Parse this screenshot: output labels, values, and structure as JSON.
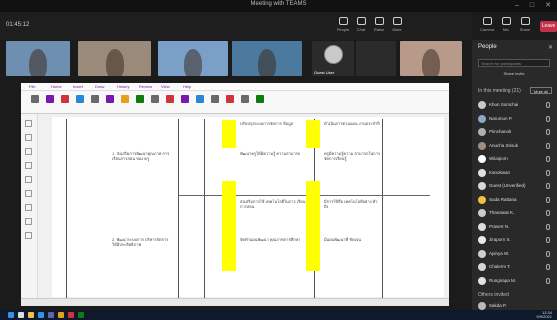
{
  "window": {
    "title": "Meeting with TEAMS",
    "controls": [
      "–",
      "□",
      "✕"
    ]
  },
  "meeting": {
    "name": "01:45:12",
    "toolbar": [
      {
        "icon": "people-icon",
        "label": "People"
      },
      {
        "icon": "chat-icon",
        "label": "Chat"
      },
      {
        "icon": "hand-icon",
        "label": "Raise"
      },
      {
        "icon": "more-icon",
        "label": "More"
      },
      {
        "icon": "camera-icon",
        "label": "Camera"
      },
      {
        "icon": "mic-icon",
        "label": "Mic"
      },
      {
        "icon": "share-icon",
        "label": "Share"
      }
    ],
    "leave_label": "Leave"
  },
  "tiles": [
    {
      "name": "",
      "bg": "#6f8fb0"
    },
    {
      "name": "",
      "bg": "#9a8a7a"
    },
    {
      "name": "",
      "bg": "#7aa0c8"
    },
    {
      "name": "",
      "bg": "#4c7a9e"
    },
    {
      "name": "Guest User",
      "bg": "#2b2b2b"
    },
    {
      "name": "",
      "bg": "#2b2b2b"
    },
    {
      "name": "",
      "bg": "#b79a8a"
    }
  ],
  "onenote": {
    "tabs": [
      "File",
      "Home",
      "Insert",
      "Draw",
      "History",
      "Review",
      "View",
      "Help"
    ],
    "page_rows": [
      {
        "left": "",
        "mid1": "ปรับปรุงระบบการจัดการ ข้อมูล",
        "mid2": "ดำเนินการตามแผน งานประจำปี"
      },
      {
        "left": "1. ส่งเสริมการพัฒนาคุณภาพ การเรียนการสอน ของ ครู",
        "mid1": "พัฒนาครูให้มีความรู้ ความสามารถ",
        "mid2": "ครูมีความรู้ความ สามารถในการ จัดการเรียนรู้"
      },
      {
        "left": "",
        "mid1": "ส่งเสริมการใช้ เทคโนโลยีในการ เรียนการสอน",
        "mid2": "มีการใช้สื่อ เทคโนโลยีอย่าง ทั่วถึง"
      },
      {
        "left": "2. พัฒนาระบบการ บริหารจัดการ ให้มีประสิทธิภาพ",
        "mid1": "จัดทำแผนพัฒนา คุณภาพการศึกษา",
        "mid2": "มีแผนพัฒนาที่ ชัดเจน"
      }
    ]
  },
  "panel": {
    "title": "People",
    "search_placeholder": "Search for participants",
    "share_label": "Share invite",
    "in_meeting_label": "In this meeting (21)",
    "mute_all": "Mute all",
    "participants": [
      {
        "name": "Khun Somchai",
        "color": "#c9c9c9"
      },
      {
        "name": "Narumon P.",
        "color": "#8aa7c7"
      },
      {
        "name": "Pimchanok",
        "color": "#b0b0b0"
      },
      {
        "name": "Anucha Srisuk",
        "color": "#a58b78"
      },
      {
        "name": "Wilaiporn",
        "color": "#ffffff"
      },
      {
        "name": "Kanokwan",
        "color": "#e0e0e0"
      },
      {
        "name": "Guest (Unverified)",
        "color": "#d8d8d8"
      },
      {
        "name": "Suda Rattana",
        "color": "#f0c040"
      },
      {
        "name": "Thanawat K.",
        "color": "#cccccc"
      },
      {
        "name": "Prasert N.",
        "color": "#dddddd"
      },
      {
        "name": "Jiraporn S.",
        "color": "#e8e8e8"
      },
      {
        "name": "Apinya W.",
        "color": "#cfcfcf"
      },
      {
        "name": "Chalerm T.",
        "color": "#d5d5d5"
      },
      {
        "name": "Rungnapa M.",
        "color": "#e2e2e2"
      }
    ],
    "others_label": "Others invited",
    "others": [
      {
        "name": "Sakda P.",
        "color": "#bbbbbb"
      }
    ]
  },
  "taskbar": {
    "time": "12:34",
    "date": "9/9/2021"
  }
}
